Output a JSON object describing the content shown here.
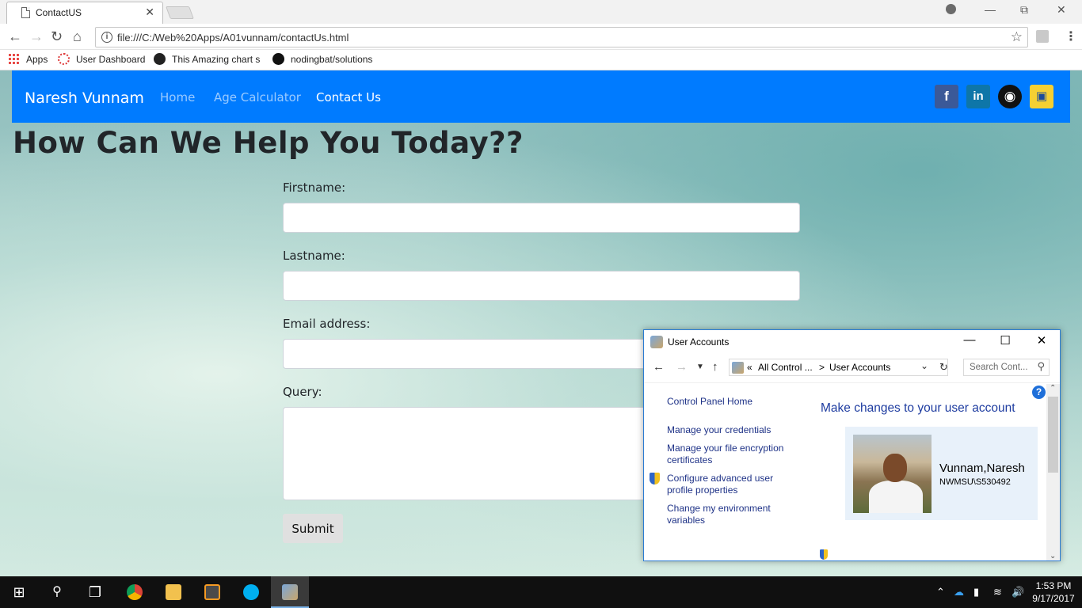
{
  "browser": {
    "tab_title": "ContactUS",
    "tab_close": "✕",
    "url": "file:///C:/Web%20Apps/A01vunnam/contactUs.html",
    "bookmarks": [
      {
        "label": "Apps"
      },
      {
        "label": "User Dashboard"
      },
      {
        "label": "This Amazing chart sl"
      },
      {
        "label": "nodingbat/solutions"
      }
    ]
  },
  "site": {
    "brand": "Naresh Vunnam",
    "nav": [
      {
        "label": "Home"
      },
      {
        "label": "Age Calculator"
      },
      {
        "label": "Contact Us"
      }
    ],
    "social": [
      "facebook-icon",
      "linkedin-icon",
      "github-icon",
      "profile-badge-icon"
    ],
    "heading": "How Can We Help You Today??",
    "form": {
      "firstname_label": "Firstname:",
      "lastname_label": "Lastname:",
      "email_label": "Email address:",
      "query_label": "Query:",
      "submit_label": "Submit"
    },
    "colors": {
      "navbar": "#007bff"
    }
  },
  "user_accounts": {
    "title": "User Accounts",
    "breadcrumb": [
      "«",
      "All Control ...",
      ">",
      "User Accounts"
    ],
    "search_placeholder": "Search Cont...",
    "links": [
      "Control Panel Home",
      "Manage your credentials",
      "Manage your file encryption certificates",
      "Configure advanced user profile properties",
      "Change my environment variables"
    ],
    "heading": "Make changes to your user account",
    "user_name": "Vunnam,Naresh",
    "account_id": "NWMSU\\S530492",
    "help": "?"
  },
  "taskbar": {
    "time": "1:53 PM",
    "date": "9/17/2017"
  }
}
